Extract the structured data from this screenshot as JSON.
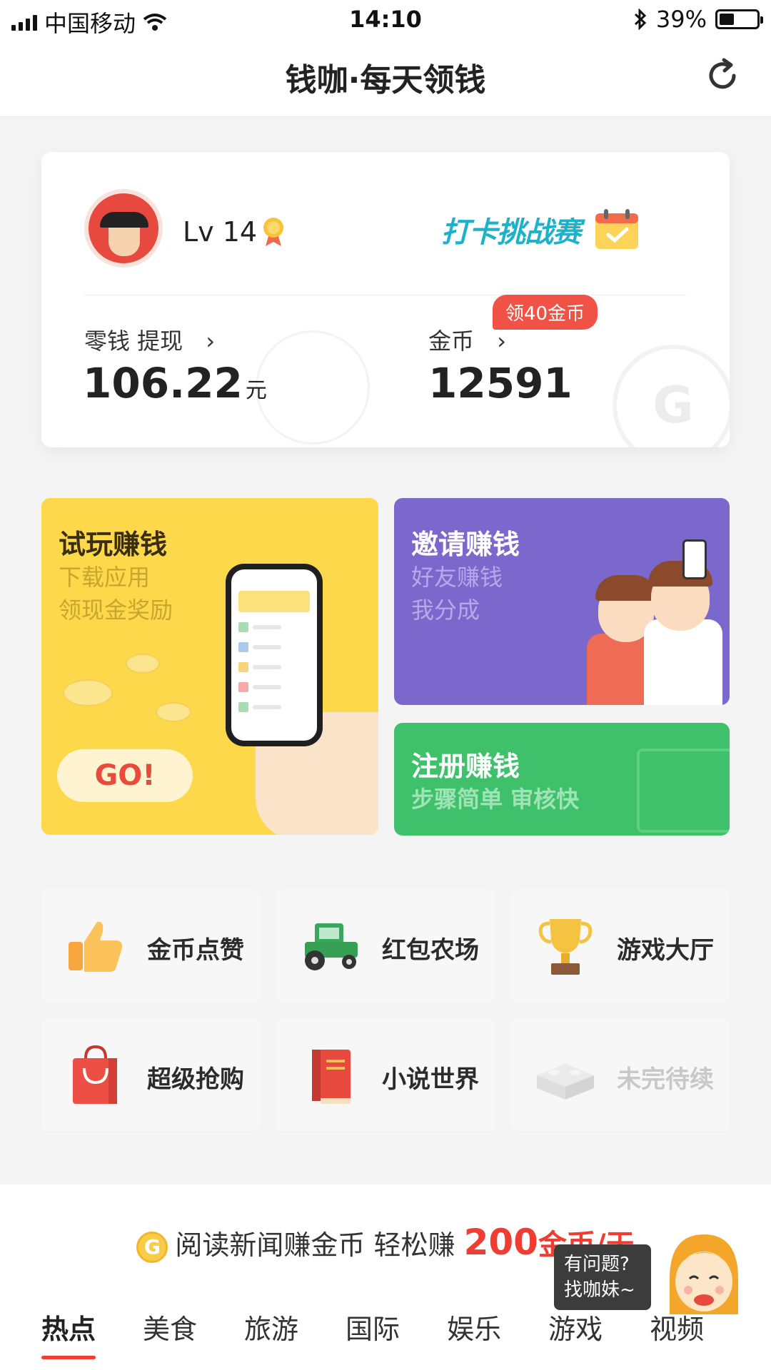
{
  "status_bar": {
    "carrier": "中国移动",
    "time": "14:10",
    "battery": "39%",
    "battery_level": 0.39
  },
  "header": {
    "title": "钱咖·每天领钱",
    "refresh_icon": "refresh-icon"
  },
  "account": {
    "level": "Lv 14",
    "challenge": "打卡挑战赛",
    "balance_label": "零钱 提现",
    "balance_value": "106.22",
    "balance_unit": "元",
    "coin_label": "金币",
    "coin_value": "12591",
    "coin_badge": "领40金币",
    "arrow": "›"
  },
  "promo": {
    "trial": {
      "title": "试玩赚钱",
      "line1": "下载应用",
      "line2": "领现金奖励",
      "go": "GO!"
    },
    "invite": {
      "title": "邀请赚钱",
      "line1": "好友赚钱",
      "line2": "我分成"
    },
    "register": {
      "title": "注册赚钱",
      "line1": "步骤简单 审核快"
    }
  },
  "features": [
    {
      "label": "金币点赞",
      "icon": "thumbs-up-icon"
    },
    {
      "label": "红包农场",
      "icon": "tractor-icon"
    },
    {
      "label": "游戏大厅",
      "icon": "trophy-icon"
    },
    {
      "label": "超级抢购",
      "icon": "shopping-bag-icon"
    },
    {
      "label": "小说世界",
      "icon": "book-icon"
    },
    {
      "label": "未完待续",
      "icon": "lego-brick-icon"
    }
  ],
  "news": {
    "coin_symbol": "G",
    "headline_a": "阅读新闻赚金币 轻松赚",
    "headline_big": "200",
    "headline_b": "金币/天",
    "tabs": [
      "热点",
      "美食",
      "旅游",
      "国际",
      "娱乐",
      "游戏",
      "视频"
    ],
    "active_tab": 0,
    "helper_line1": "有问题?",
    "helper_line2": "找咖妹~"
  },
  "colors": {
    "accent_red": "#ef3d33",
    "yellow_tile": "#fdd84a",
    "purple_tile": "#7b68cc",
    "green_tile": "#3ec16a"
  }
}
